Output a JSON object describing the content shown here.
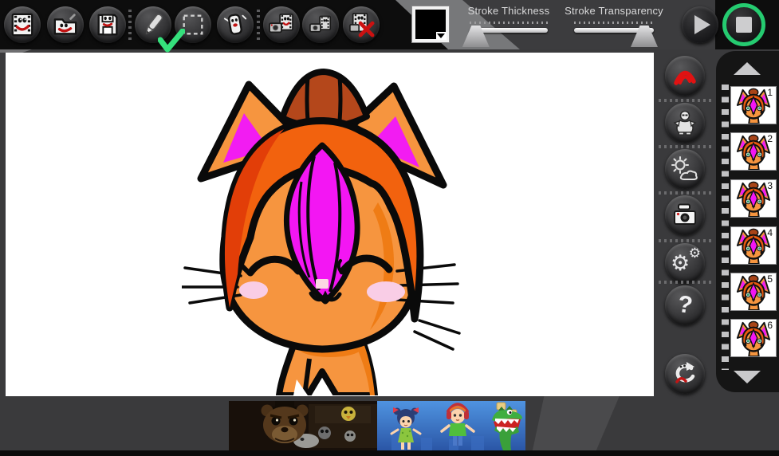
{
  "app": {
    "bg_color": "#3a3a3c",
    "toolbar_color": "#0d0d0d",
    "canvas_color": "#ffffff",
    "accent_green": "#25cb70",
    "accent_red": "#cc1111"
  },
  "toolbar": {
    "file_buttons": [
      {
        "name": "new-animation",
        "icon": "filmstrip-face-icon"
      },
      {
        "name": "open-project",
        "icon": "folder-face-icon"
      },
      {
        "name": "save-project",
        "icon": "floppy-face-icon"
      }
    ],
    "tool_buttons": [
      {
        "name": "pencil-tool",
        "icon": "pencil-icon",
        "selected": true
      },
      {
        "name": "select-tool",
        "icon": "marquee-icon",
        "selected": false
      },
      {
        "name": "eraser-tool",
        "icon": "eraser-face-icon",
        "selected": false
      }
    ],
    "frame_buttons": [
      {
        "name": "copy-frame",
        "icon": "film-camera-icon"
      },
      {
        "name": "insert-frame",
        "icon": "film-camera-small-icon"
      },
      {
        "name": "delete-frame",
        "icon": "film-red-x-icon"
      }
    ],
    "color_swatch": {
      "current_color": "#000000"
    },
    "sliders": [
      {
        "label": "Stroke Thickness",
        "value_pct": 8
      },
      {
        "label": "Stroke Transparency",
        "value_pct": 88
      }
    ],
    "playback": [
      {
        "name": "play",
        "icon": "play-icon",
        "highlighted": false
      },
      {
        "name": "stop",
        "icon": "stop-icon",
        "highlighted": true
      }
    ]
  },
  "sidebar": {
    "buttons": [
      {
        "name": "record",
        "icon": "red-arc-icon"
      },
      {
        "name": "characters",
        "icon": "character-icon"
      },
      {
        "name": "scenery",
        "icon": "sun-cloud-icon"
      },
      {
        "name": "photo",
        "icon": "camera-icon"
      },
      {
        "name": "settings",
        "icon": "gears-icon"
      },
      {
        "name": "help",
        "icon": "question-face-icon"
      },
      {
        "name": "undo",
        "icon": "undo-arrow-face-icon"
      }
    ]
  },
  "frames_panel": {
    "up_icon": "up-arrow-icon",
    "down_icon": "down-arrow-icon",
    "frames": [
      {
        "number": "1"
      },
      {
        "number": "2"
      },
      {
        "number": "3"
      },
      {
        "number": "4"
      },
      {
        "number": "5"
      },
      {
        "number": "6"
      }
    ]
  },
  "canvas": {
    "artwork": "orange-cat-with-orange-helmet-and-magenta-bang"
  },
  "ads": {
    "left": "dark-animatronic-bear-game",
    "right": "cartoon-kids-and-dinosaur-game"
  },
  "glyphs": {
    "gear_big": "⚙",
    "gear_small": "⚙",
    "question": "?"
  }
}
